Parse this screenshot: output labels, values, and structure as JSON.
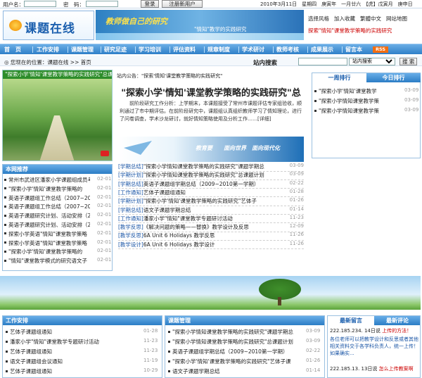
{
  "login": {
    "user_label": "用户名：",
    "pass_label": "密　码：",
    "login_btn": "登录",
    "register_btn": "注册新用户",
    "date": "2010年3月11日　星期四　庚寅年　一月廿六　【虎】戊寅月　庚申日"
  },
  "header": {
    "logo_text": "课题在线",
    "banner_title": "教师做自己的研究",
    "banner_sub": "\"情知\"教学的实践研究",
    "links": [
      "选择风格",
      "加入收藏",
      "繁體中文",
      "网站地图"
    ],
    "marquee": "探索\"情知\"课堂教学策略的实践研究"
  },
  "nav": {
    "items": [
      "首　页",
      "工作安排",
      "课题管理",
      "研究足迹",
      "学习培训",
      "评估资料",
      "规章制度",
      "学术研讨",
      "教师考核",
      "成果展示",
      "留言本"
    ],
    "rss": "RSS"
  },
  "location": {
    "text": "◎ 您现在的位置：课题在线 >> 首页"
  },
  "search": {
    "label": "站内搜索",
    "scope": "站内搜索",
    "button": "搜 索"
  },
  "slide": {
    "caption": "\"探索小学'情知'课堂教学策略的实践研究\"总课"
  },
  "recommend": {
    "title": "本网推荐",
    "items": [
      {
        "text": "常州市武进区潘家小学课题组成员考",
        "date": "02-01"
      },
      {
        "text": "\"探索小学'情知'课堂教学策略的",
        "date": "02-01"
      },
      {
        "text": "英语子课题组工作总结（2007~2008第",
        "date": "02-01"
      },
      {
        "text": "英语子课题组工作总结（2007~2008第",
        "date": "02-01"
      },
      {
        "text": "英语子课题研究计划、活动安排（20",
        "date": "02-01"
      },
      {
        "text": "英语子课题研究计划、活动安排（20",
        "date": "02-01"
      },
      {
        "text": "探索小学英语\"情知\"课堂教学策略",
        "date": "02-01"
      },
      {
        "text": "探索小学英语\"情知\"课堂教学策略",
        "date": "02-01"
      },
      {
        "text": "\"探索小学'情知'课堂教学策略的",
        "date": "02-01"
      },
      {
        "text": "\"情知\"课堂教学模式的研究语文子",
        "date": "02-01"
      }
    ]
  },
  "center": {
    "announce": "站内公告：\"探索'情知'课堂教学策略的实践研究\"",
    "headline": "\"探索小学'情知'课堂教学策略的实践研究\"总",
    "summary": "　　前阶段研究工作分析：上学期末，本课题接受了常州市课题评估专家组验收，顺利通过了市中期评估。在前阶段研究中，课题组认真组织教师学习了情知理论，进行了问卷调查，学术沙龙研讨，就好情知策略使用及分析工作……[详细]",
    "slogan": "教育要　　面向世界　面向现代化",
    "list": [
      {
        "cat": "[学期总结]",
        "title": "\"探索小学情知课堂教学策略的实践研究\"课题学期总",
        "date": "03-09"
      },
      {
        "cat": "[学期计划]",
        "title": "\"探索小学情知课堂教学策略的实践研究\"总课题计划",
        "date": "03-09"
      },
      {
        "cat": "[学期总结]",
        "title": "英语子课题组学期总结（2009~2010第一学期）",
        "date": "02-22"
      },
      {
        "cat": "[工作通知]",
        "title": "艺体子课题组通知",
        "date": "01-28"
      },
      {
        "cat": "[学期计划]",
        "title": "\"探索小学'情知'课堂教学策略的实践研究\"艺体子",
        "date": "01-26"
      },
      {
        "cat": "[学期总结]",
        "title": "语文子课题学期总结",
        "date": "01-14"
      },
      {
        "cat": "[工作通知]",
        "title": "潘家小学\"情知\"课堂教学专题研讨活动",
        "date": "11-23"
      },
      {
        "cat": "[教学反思]",
        "title": "《解决问题的策略——替换》教学设计及反思",
        "date": "12-09"
      },
      {
        "cat": "[教学反思]",
        "title": "6A Unit 6 Holidays 教学反思",
        "date": "11-26"
      },
      {
        "cat": "[教学设计]",
        "title": "6A Unit 6 Holidays 教学设计",
        "date": "11-26"
      }
    ]
  },
  "rank": {
    "tabs": [
      "一周排行",
      "今日排行"
    ],
    "items": [
      {
        "text": "\"探索小学'情知'课堂教学",
        "date": "03-09"
      },
      {
        "text": "\"探索小学情知课堂教学策",
        "date": "03-09"
      },
      {
        "text": "\"探索小学情知课堂教学策",
        "date": "03-09"
      }
    ]
  },
  "work": {
    "title": "工作安排",
    "items": [
      {
        "text": "艺体子课题组通知",
        "date": "01-28"
      },
      {
        "text": "潘家小学\"情知\"课堂教学专题研讨活动",
        "date": "11-23"
      },
      {
        "text": "艺体子课题组通知",
        "date": "11-23"
      },
      {
        "text": "语文子课题组会议通知",
        "date": "11-19"
      },
      {
        "text": "艺体子课题组通知",
        "date": "10-29"
      }
    ]
  },
  "manage": {
    "title": "课题管理",
    "items": [
      {
        "text": "\"探索小学情知课堂教学策略的实践研究\"课题学期总",
        "date": "03-09"
      },
      {
        "text": "\"探索小学情知课堂教学策略的实践研究\"总课题计划",
        "date": "03-09"
      },
      {
        "text": "英语子课题组学期总结（2009~2010第一学期）",
        "date": "02-22"
      },
      {
        "text": "\"探索小学'情知'课堂教学策略的实践研究\"艺体子课",
        "date": "01-26"
      },
      {
        "text": "语文子课题学期总结",
        "date": "01-14"
      }
    ]
  },
  "visitor": {
    "tabs": [
      "最新留言",
      "最新评论"
    ],
    "lines": [
      {
        "ip": "222.185.234. 14日说",
        "msg": "上传的方法！"
      },
      {
        "ip": "",
        "msg": "各位老师可以把教学设计和反思或者其他相关资料交于各学科负责人，统一上传！如果确实..."
      },
      {
        "ip": "222.185.13. 13日说",
        "msg": "怎么上传教案啊"
      }
    ]
  }
}
